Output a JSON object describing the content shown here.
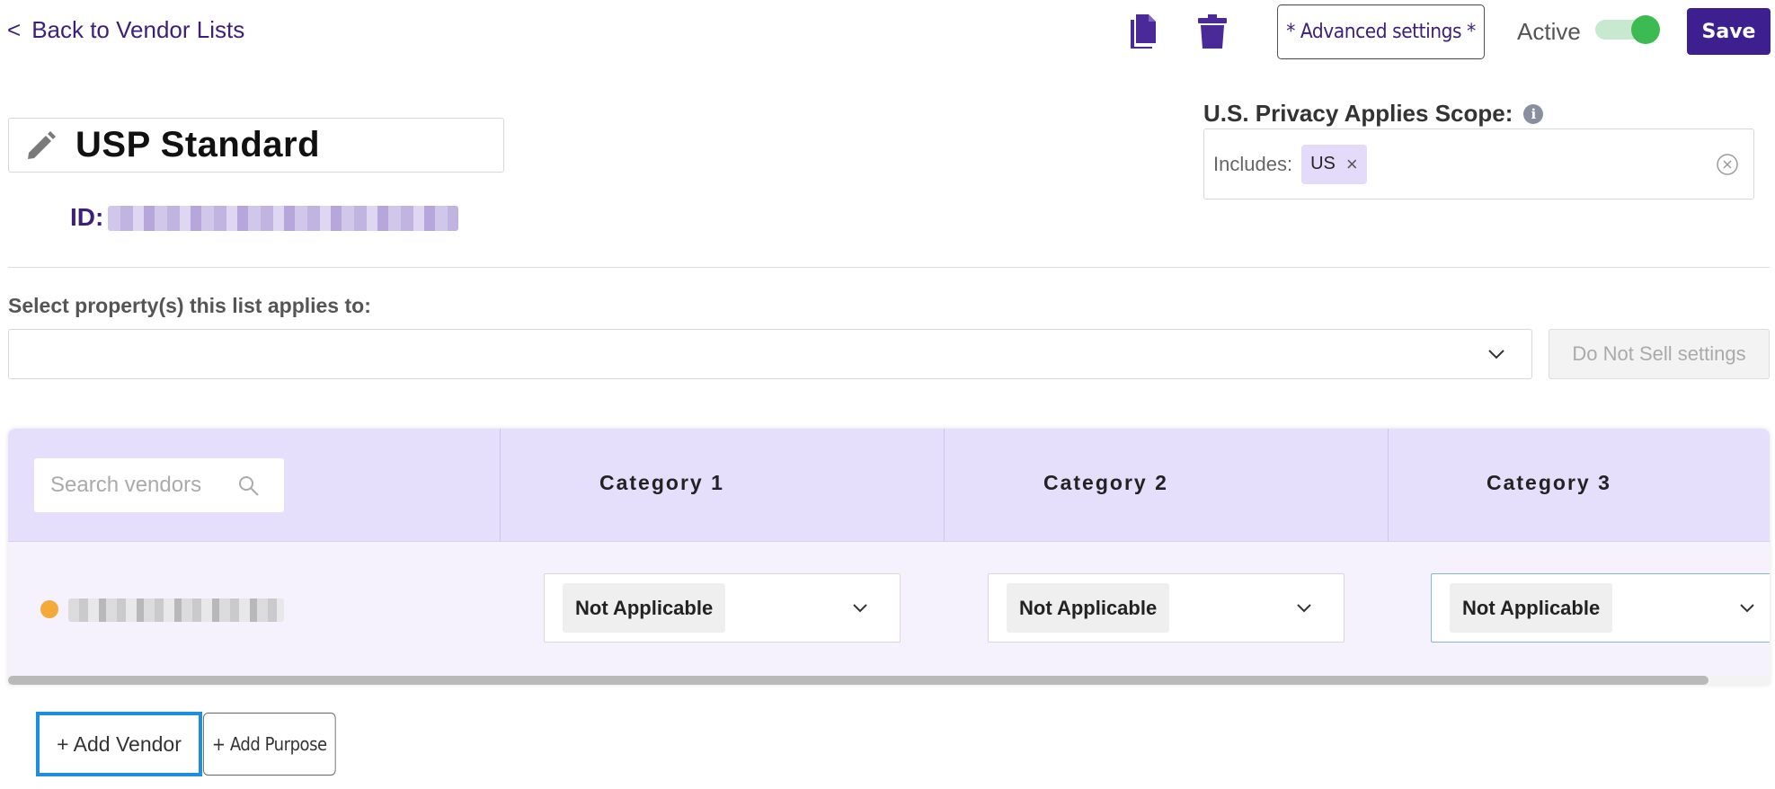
{
  "header": {
    "back_link": "Back to Vendor Lists",
    "back_chevron": "<",
    "copy_icon": "copy-icon",
    "delete_icon": "trash-icon",
    "advanced_settings_label": "* Advanced settings *",
    "active_label": "Active",
    "active_toggle_on": true,
    "save_label": "Save"
  },
  "list": {
    "title": "USP Standard",
    "id_label": "ID:"
  },
  "scope": {
    "label": "U.S. Privacy Applies Scope:",
    "info_icon_glyph": "i",
    "includes_label": "Includes:",
    "chips": [
      {
        "label": "US",
        "remove": "×"
      }
    ]
  },
  "properties": {
    "label": "Select property(s) this list applies to:",
    "value": "",
    "do_not_sell_label": "Do Not Sell settings"
  },
  "table": {
    "search_placeholder": "Search vendors",
    "columns": [
      {
        "label": "Category 1"
      },
      {
        "label": "Category 2"
      },
      {
        "label": "Category 3"
      }
    ],
    "rows": [
      {
        "status_color": "#f4a93b",
        "values": [
          "Not Applicable",
          "Not Applicable",
          "Not Applicable"
        ]
      }
    ]
  },
  "actions": {
    "add_vendor_label": "+ Add Vendor",
    "add_purpose_label": "+ Add Purpose"
  },
  "colors": {
    "brand_purple": "#3d1f8f",
    "header_bg": "#e6dffb",
    "toggle_on": "#3dbb53",
    "focus_blue": "#1e8fe0"
  }
}
